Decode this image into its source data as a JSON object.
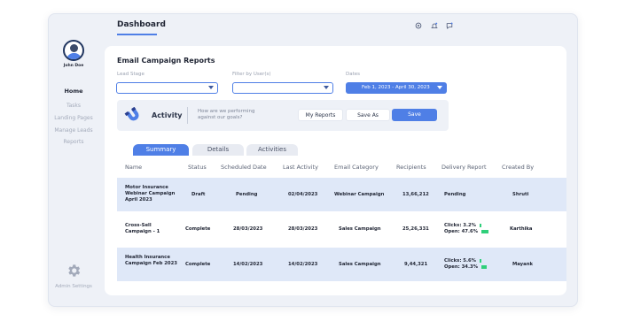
{
  "user": {
    "name": "John Doe"
  },
  "nav": {
    "items": [
      {
        "label": "Home",
        "active": true
      },
      {
        "label": "Tasks",
        "active": false
      },
      {
        "label": "Landing Pages",
        "active": false
      },
      {
        "label": "Manage Leads",
        "active": false
      },
      {
        "label": "Reports",
        "active": false
      }
    ],
    "admin_settings": "Admin Settings"
  },
  "header": {
    "title": "Dashboard",
    "icons": [
      "settings-icon",
      "bell-icon",
      "chat-icon"
    ]
  },
  "report": {
    "title": "Email Campaign Reports",
    "filters": {
      "lead_stage_label": "Lead Stage",
      "lead_stage_value": "",
      "user_label": "Filter by User(s)",
      "user_value": "",
      "dates_label": "Dates",
      "dates_value": "Feb 1, 2023 - April 30, 2023"
    },
    "activity": {
      "label": "Activity",
      "question": "How are we performing against our goals?",
      "my_reports": "My Reports",
      "save_as": "Save As",
      "save": "Save"
    },
    "tabs": [
      {
        "label": "Summary",
        "active": true
      },
      {
        "label": "Details",
        "active": false
      },
      {
        "label": "Activities",
        "active": false
      }
    ],
    "columns": [
      "Name",
      "Status",
      "Scheduled Date",
      "Last Activity",
      "Email Category",
      "Recipients",
      "Delivery Report",
      "Created By"
    ],
    "rows": [
      {
        "name": "Motor Insurance Webinar Campaign April 2023",
        "status": "Draft",
        "scheduled": "Pending",
        "last_activity": "02/04/2023",
        "category": "Webinar Campaign",
        "recipients": "13,66,212",
        "delivery": "Pending",
        "created_by": "Shruti"
      },
      {
        "name": "Cross-Sell Campaign - 1",
        "status": "Complete",
        "scheduled": "28/03/2023",
        "last_activity": "28/03/2023",
        "category": "Sales Campaign",
        "recipients": "25,26,331",
        "delivery_clicks": "Clicks: 3.2%",
        "delivery_opens": "Open: 47.6%",
        "clicks_pct": 3.2,
        "opens_pct": 47.6,
        "created_by": "Karthika"
      },
      {
        "name": "Health Insurance Campaign Feb 2023",
        "status": "Complete",
        "scheduled": "14/02/2023",
        "last_activity": "14/02/2023",
        "category": "Sales Campaign",
        "recipients": "9,44,321",
        "delivery_clicks": "Clicks: 5.6%",
        "delivery_opens": "Open: 34.3%",
        "clicks_pct": 5.6,
        "opens_pct": 34.3,
        "created_by": "Mayank"
      }
    ]
  },
  "colors": {
    "accent": "#4f7fe6",
    "success": "#2fcf7a",
    "row_highlight": "#dfe8f8"
  }
}
